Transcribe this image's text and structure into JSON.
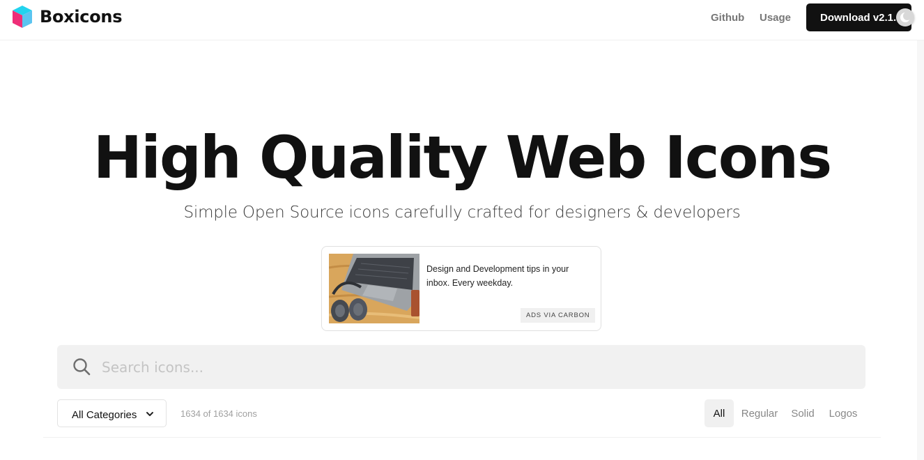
{
  "navbar": {
    "brand_name": "Boxicons",
    "links": [
      {
        "label": "Github"
      },
      {
        "label": "Usage"
      }
    ],
    "download_label": "Download v2.1.4"
  },
  "hero": {
    "title": "High Quality Web Icons",
    "subtitle": "Simple Open Source icons carefully crafted for designers & developers"
  },
  "ad": {
    "text": "Design and Development tips in your inbox. Every weekday.",
    "badge": "ADS VIA CARBON"
  },
  "search": {
    "placeholder": "Search icons...",
    "value": ""
  },
  "toolbar": {
    "category_selected": "All Categories",
    "count_text": "1634 of 1634 icons",
    "filters": [
      {
        "label": "All",
        "active": true
      },
      {
        "label": "Regular",
        "active": false
      },
      {
        "label": "Solid",
        "active": false
      },
      {
        "label": "Logos",
        "active": false
      }
    ]
  },
  "icons": {
    "logo": "boxicons-cube-logo",
    "theme": "moon-icon",
    "search": "search-icon",
    "dropdown": "chevron-down-icon"
  },
  "colors": {
    "download_bg": "#111111",
    "logo_cyan": "#1ed4e8",
    "logo_pink": "#ee2e78",
    "search_bg": "#f1f1f1",
    "active_filter_bg": "#f0f0f0"
  }
}
